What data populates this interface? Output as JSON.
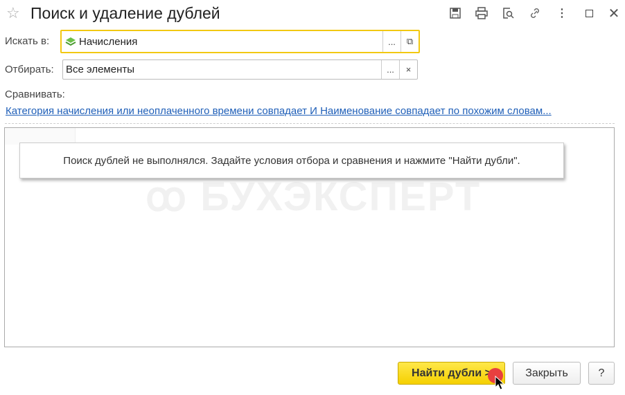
{
  "window": {
    "title": "Поиск и удаление дублей",
    "toolbar_icons": [
      "save-icon",
      "print-icon",
      "preview-icon",
      "link-icon",
      "more-icon",
      "maximize-icon",
      "close-icon"
    ]
  },
  "search_in": {
    "label": "Искать в:",
    "value": "Начисления",
    "select_label": "...",
    "open_label": "⧉"
  },
  "filter": {
    "label": "Отбирать:",
    "value": "Все элементы",
    "select_label": "...",
    "clear_label": "×"
  },
  "compare": {
    "label": "Сравнивать:",
    "link": "Категория начисления или неоплаченного времени совпадает И Наименование совпадает по похожим словам..."
  },
  "results": {
    "message": "Поиск дублей не выполнялся.  Задайте условия отбора и сравнения и нажмите \"Найти дубли\".",
    "watermark": "БУХЭКСПЕРТ"
  },
  "footer": {
    "find_label": "Найти дубли >",
    "close_label": "Закрыть",
    "help_label": "?"
  },
  "colors": {
    "accent": "#f5d000",
    "link": "#1f5fb8",
    "focus_border": "#f2c811"
  }
}
